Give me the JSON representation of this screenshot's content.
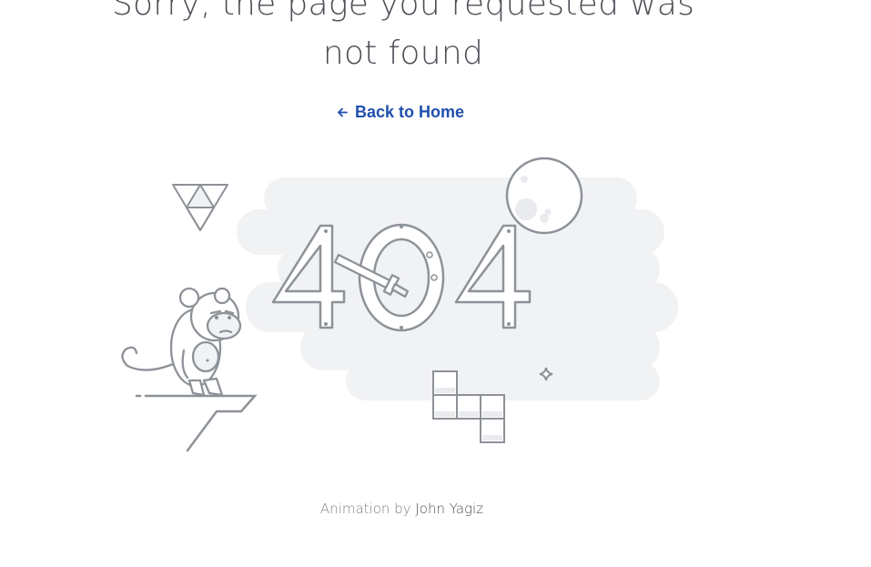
{
  "error_page": {
    "headline": "Sorry, the page you requested was not found",
    "back_link": {
      "label": "Back to Home",
      "icon": "arrow-left-icon",
      "color": "#1f4fae"
    },
    "illustration": {
      "digits": [
        "4",
        "0",
        "4"
      ],
      "elements": [
        "cloud",
        "moon",
        "triangle",
        "monkey",
        "cliff",
        "sword",
        "tetris-blocks",
        "sparkle"
      ]
    },
    "credit": {
      "prefix": "Animation by",
      "author": "John Yagiz"
    }
  }
}
